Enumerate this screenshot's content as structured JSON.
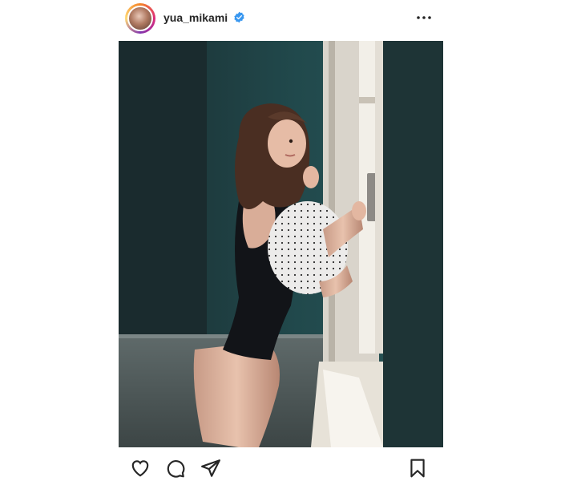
{
  "header": {
    "username": "yua_mikami",
    "verified": true,
    "avatar_icon": "profile-avatar",
    "more_icon": "more-dots-icon"
  },
  "post": {
    "image_icon": "post-photo"
  },
  "actions": {
    "like_icon": "heart-icon",
    "comment_icon": "comment-icon",
    "share_icon": "paper-plane-icon",
    "save_icon": "bookmark-icon"
  },
  "colors": {
    "verified_blue": "#3897f0",
    "text": "#262626"
  }
}
